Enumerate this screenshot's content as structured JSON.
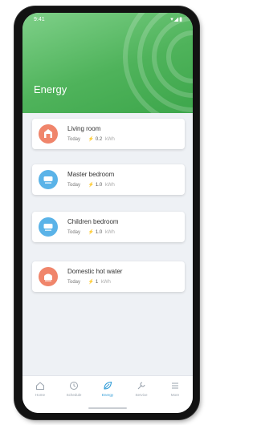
{
  "status": {
    "time": "9:41",
    "icons": "▾◢▮"
  },
  "page_title": "Energy",
  "cards": [
    {
      "name": "Living room",
      "period": "Today",
      "value": "0.2",
      "unit": "kWh",
      "icon": "fireplace-icon",
      "color": "#f0856b"
    },
    {
      "name": "Master bedroom",
      "period": "Today",
      "value": "1.0",
      "unit": "kWh",
      "icon": "air-conditioner-icon",
      "color": "#5ab3e8"
    },
    {
      "name": "Children bedroom",
      "period": "Today",
      "value": "1.0",
      "unit": "kWh",
      "icon": "air-conditioner-icon",
      "color": "#5ab3e8"
    },
    {
      "name": "Domestic hot water",
      "period": "Today",
      "value": "1",
      "unit": "kWh",
      "icon": "water-heater-icon",
      "color": "#f0856b"
    }
  ],
  "nav": [
    {
      "label": "Home",
      "icon": "home-icon"
    },
    {
      "label": "Schedule",
      "icon": "clock-icon"
    },
    {
      "label": "Energy",
      "icon": "leaf-icon",
      "active": true
    },
    {
      "label": "Service",
      "icon": "wrench-icon"
    },
    {
      "label": "More",
      "icon": "menu-icon"
    }
  ],
  "colors": {
    "header": "#4fb35b",
    "active": "#2f9bd6"
  }
}
